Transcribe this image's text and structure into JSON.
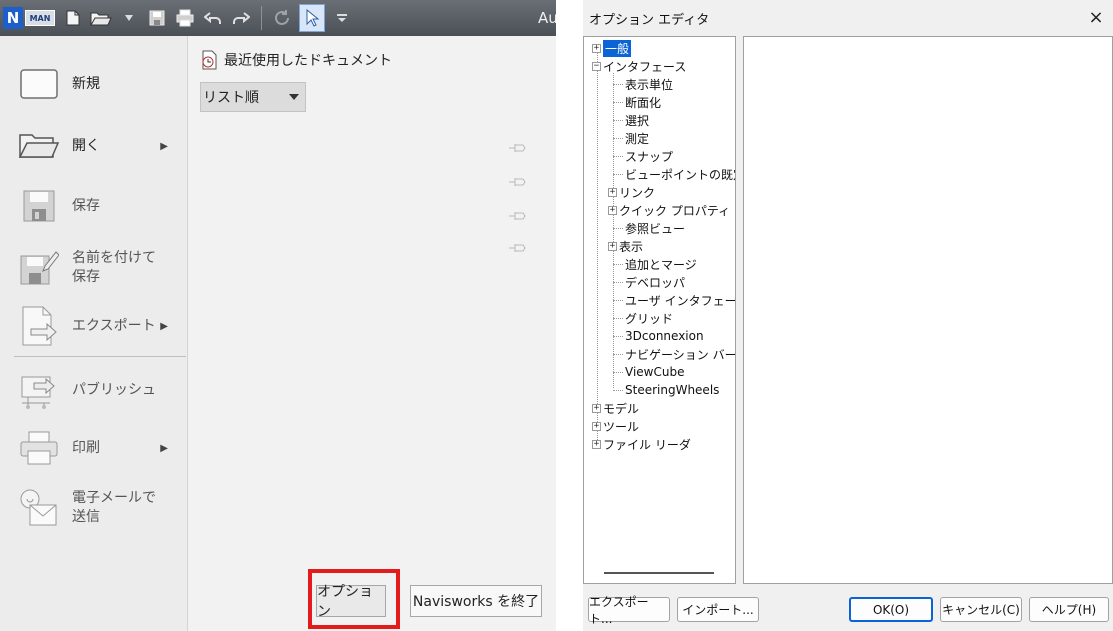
{
  "app": {
    "title_fragment": "Au",
    "logo_letter": "N",
    "logo_badge": "MAN"
  },
  "menu": {
    "items": [
      {
        "label": "新規",
        "icon": "new-document-icon",
        "arrow": false,
        "enabled": true
      },
      {
        "label": "開く",
        "icon": "open-folder-icon",
        "arrow": true,
        "enabled": true
      },
      {
        "label": "保存",
        "icon": "save-disk-icon",
        "arrow": false,
        "enabled": false
      },
      {
        "label": "名前を付けて保存",
        "icon": "save-as-icon",
        "arrow": false,
        "enabled": false
      },
      {
        "label": "エクスポート",
        "icon": "export-icon",
        "arrow": true,
        "enabled": false
      },
      {
        "label": "パブリッシュ",
        "icon": "publish-icon",
        "arrow": false,
        "enabled": false
      },
      {
        "label": "印刷",
        "icon": "printer-icon",
        "arrow": true,
        "enabled": false
      },
      {
        "label": "電子メールで送信",
        "icon": "email-icon",
        "arrow": false,
        "enabled": false
      }
    ]
  },
  "recent": {
    "title": "最近使用したドキュメント",
    "sort_value": "リスト順"
  },
  "footer": {
    "options_label": "オプション",
    "exit_label": "Navisworks を終了"
  },
  "dialog": {
    "title": "オプション エディタ",
    "close": "×",
    "tree": {
      "general": "一般",
      "interface": "インタフェース",
      "interface_children": [
        "表示単位",
        "断面化",
        "選択",
        "測定",
        "スナップ",
        "ビューポイントの既定値",
        "リンク",
        "クイック プロパティ",
        "参照ビュー",
        "表示",
        "追加とマージ",
        "デベロッパ",
        "ユーザ インタフェース",
        "グリッド",
        "3Dconnexion",
        "ナビゲーション バー",
        "ViewCube",
        "SteeringWheels"
      ],
      "expandable_children": [
        "リンク",
        "クイック プロパティ",
        "表示"
      ],
      "model": "モデル",
      "tools": "ツール",
      "file_readers": "ファイル リーダ"
    },
    "buttons": {
      "export": "エクスポート...",
      "import": "インポート...",
      "ok": "OK(O)",
      "cancel": "キャンセル(C)",
      "help": "ヘルプ(H)"
    }
  },
  "colors": {
    "highlight_red": "#e31b1b",
    "selection_blue": "#0a64d6"
  }
}
